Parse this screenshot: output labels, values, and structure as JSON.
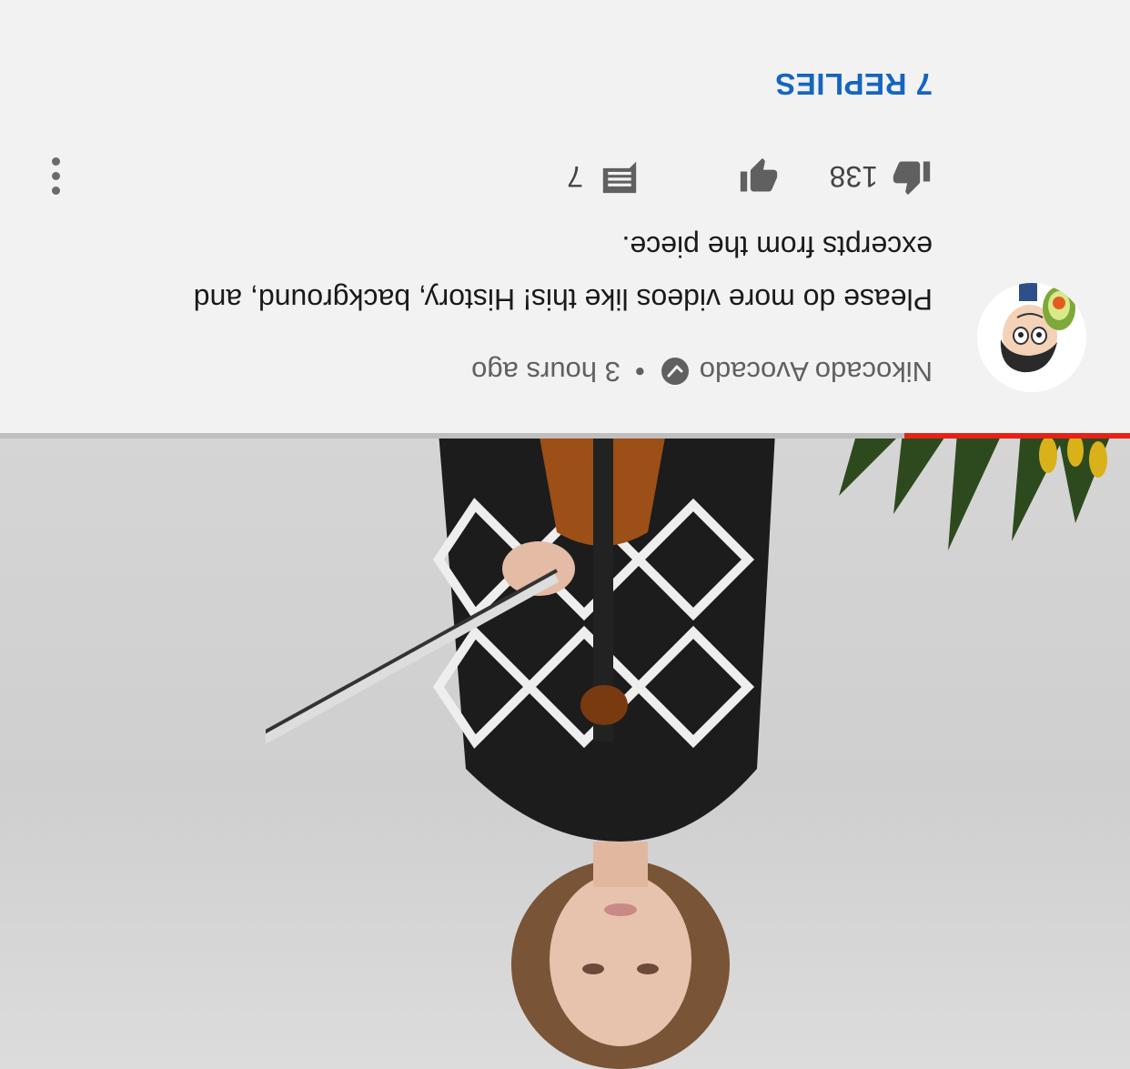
{
  "video": {
    "progress_fraction": 0.2,
    "progress_color": "#e62117"
  },
  "comment": {
    "author": "Nikocado Avocado",
    "verified_icon": "verified-check-icon",
    "separator": "•",
    "time": "3 hours ago",
    "text": "Please do more videos like this! History, background, and excerpts from the piece.",
    "likes": "138",
    "replies_count": "7",
    "replies_label": "7 REPLIES"
  },
  "icons": {
    "like": "thumbs-up-icon",
    "dislike": "thumbs-down-icon",
    "reply": "comment-icon",
    "more": "more-vertical-icon"
  }
}
